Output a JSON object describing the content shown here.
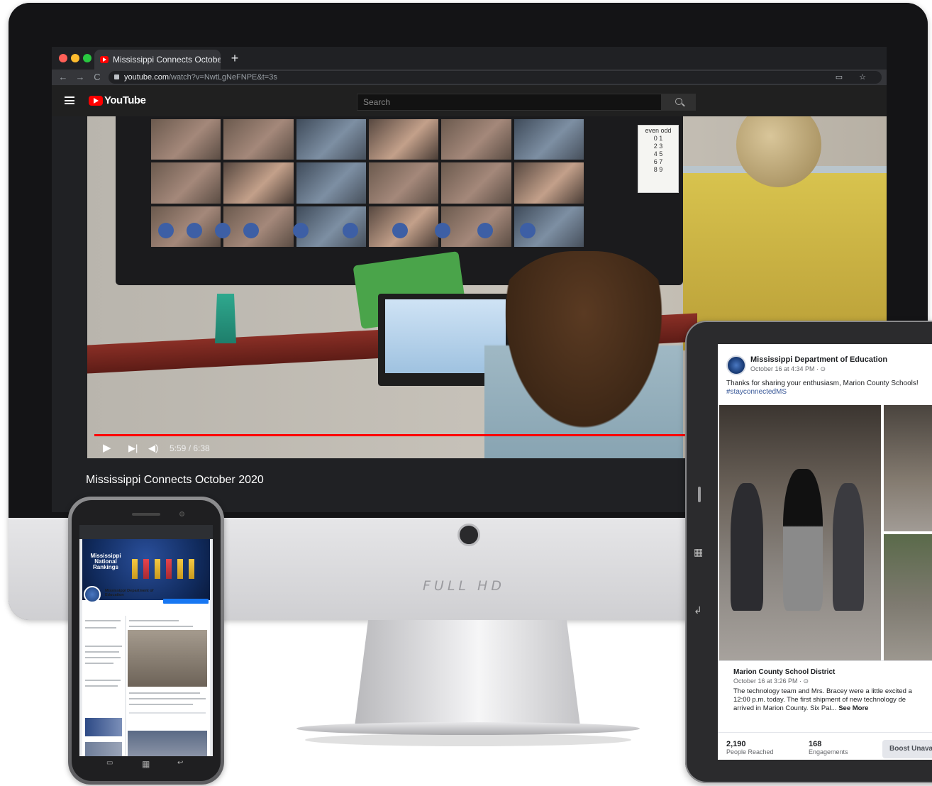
{
  "browser": {
    "tab_title": "Mississippi Connects October",
    "tab_close": "×",
    "new_tab": "+",
    "nav": {
      "back": "←",
      "forward": "→",
      "reload": "C"
    },
    "url_host": "youtube.com",
    "url_path": "/watch?v=NwtLgNeFNPE&t=3s",
    "url_icons": "▭ ☆"
  },
  "youtube": {
    "logo_text": "YouTube",
    "search_placeholder": "Search",
    "player": {
      "play_icon": "▶",
      "next_icon": "▶|",
      "volume_icon": "◀)",
      "time": "5:59 / 6:38",
      "progress": 0.94
    },
    "video_title": "Mississippi Connects October 2020",
    "classroom_chart": {
      "header_even": "even",
      "header_odd": "odd",
      "rows": [
        "0  1",
        "2  3",
        "4  5",
        "6  7",
        "8  9"
      ]
    }
  },
  "imac": {
    "badge": "FULL HD"
  },
  "tablet": {
    "post": {
      "page_name": "Mississippi Department of Education",
      "date": "October 16 at 4:34 PM · ⊙",
      "text": "Thanks for sharing your enthusiasm, Marion County Schools!",
      "hashtag": "#stayconnectedMS"
    },
    "shared": {
      "page_name": "Marion County School District",
      "date": "October 16 at 3:26 PM · ⊙",
      "line1": "The technology team and Mrs. Bracey were a little excited a",
      "line2": "12:00 p.m. today.  The first shipment of new technology de",
      "line3": "arrived in Marion County.  Six Pal...",
      "see_more": "See More"
    },
    "stats": {
      "reached_value": "2,190",
      "reached_label": "People Reached",
      "engagements_value": "168",
      "engagements_label": "Engagements",
      "boost_label": "Boost Unava"
    },
    "side_icons": {
      "grid": "▦",
      "back": "↲"
    }
  },
  "phone": {
    "banner_title": "Mississippi National Rankings",
    "page_name": "Mississippi Department of Education",
    "nav_icons": {
      "menu": "▭",
      "home": "▦",
      "back": "↩"
    }
  }
}
